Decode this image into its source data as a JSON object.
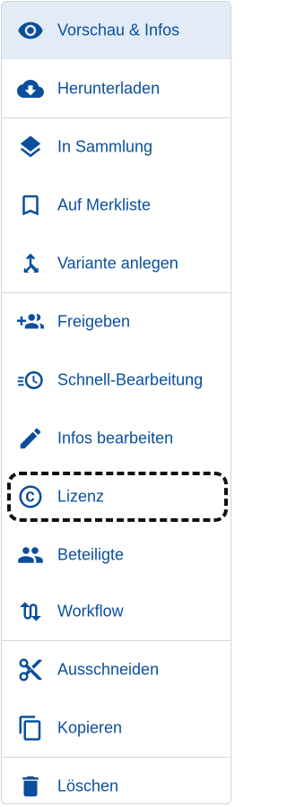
{
  "menu": {
    "items": [
      {
        "label": "Vorschau & Infos",
        "icon": "eye-icon",
        "active": true
      },
      {
        "label": "Herunterladen",
        "icon": "cloud-download-icon"
      },
      {
        "label": "In Sammlung",
        "icon": "layers-icon"
      },
      {
        "label": "Auf Merkliste",
        "icon": "bookmark-icon"
      },
      {
        "label": "Variante anlegen",
        "icon": "fork-icon"
      },
      {
        "label": "Freigeben",
        "icon": "share-people-icon"
      },
      {
        "label": "Schnell-Bearbeitung",
        "icon": "quick-edit-icon"
      },
      {
        "label": "Infos bearbeiten",
        "icon": "pencil-icon"
      },
      {
        "label": "Lizenz",
        "icon": "copyright-icon",
        "highlighted": true
      },
      {
        "label": "Beteiligte",
        "icon": "people-icon"
      },
      {
        "label": "Workflow",
        "icon": "workflow-icon"
      },
      {
        "label": "Ausschneiden",
        "icon": "scissors-icon"
      },
      {
        "label": "Kopieren",
        "icon": "copy-icon"
      },
      {
        "label": "Löschen",
        "icon": "trash-icon"
      }
    ]
  },
  "colors": {
    "accent": "#0a4f9c",
    "active_background": "#e3ebf6",
    "divider": "#d3d7dc"
  }
}
